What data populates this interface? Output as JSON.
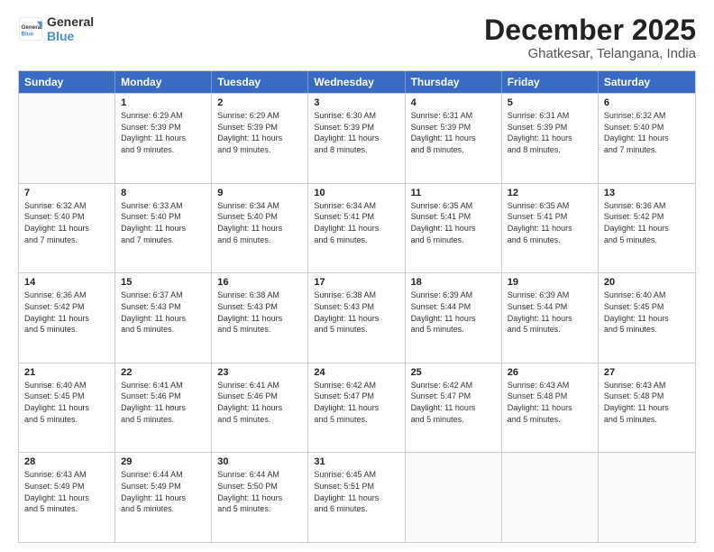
{
  "logo": {
    "line1": "General",
    "line2": "Blue"
  },
  "title": "December 2025",
  "subtitle": "Ghatkesar, Telangana, India",
  "headers": [
    "Sunday",
    "Monday",
    "Tuesday",
    "Wednesday",
    "Thursday",
    "Friday",
    "Saturday"
  ],
  "rows": [
    [
      {
        "day": "",
        "info": ""
      },
      {
        "day": "1",
        "info": "Sunrise: 6:29 AM\nSunset: 5:39 PM\nDaylight: 11 hours\nand 9 minutes."
      },
      {
        "day": "2",
        "info": "Sunrise: 6:29 AM\nSunset: 5:39 PM\nDaylight: 11 hours\nand 9 minutes."
      },
      {
        "day": "3",
        "info": "Sunrise: 6:30 AM\nSunset: 5:39 PM\nDaylight: 11 hours\nand 8 minutes."
      },
      {
        "day": "4",
        "info": "Sunrise: 6:31 AM\nSunset: 5:39 PM\nDaylight: 11 hours\nand 8 minutes."
      },
      {
        "day": "5",
        "info": "Sunrise: 6:31 AM\nSunset: 5:39 PM\nDaylight: 11 hours\nand 8 minutes."
      },
      {
        "day": "6",
        "info": "Sunrise: 6:32 AM\nSunset: 5:40 PM\nDaylight: 11 hours\nand 7 minutes."
      }
    ],
    [
      {
        "day": "7",
        "info": "Sunrise: 6:32 AM\nSunset: 5:40 PM\nDaylight: 11 hours\nand 7 minutes."
      },
      {
        "day": "8",
        "info": "Sunrise: 6:33 AM\nSunset: 5:40 PM\nDaylight: 11 hours\nand 7 minutes."
      },
      {
        "day": "9",
        "info": "Sunrise: 6:34 AM\nSunset: 5:40 PM\nDaylight: 11 hours\nand 6 minutes."
      },
      {
        "day": "10",
        "info": "Sunrise: 6:34 AM\nSunset: 5:41 PM\nDaylight: 11 hours\nand 6 minutes."
      },
      {
        "day": "11",
        "info": "Sunrise: 6:35 AM\nSunset: 5:41 PM\nDaylight: 11 hours\nand 6 minutes."
      },
      {
        "day": "12",
        "info": "Sunrise: 6:35 AM\nSunset: 5:41 PM\nDaylight: 11 hours\nand 6 minutes."
      },
      {
        "day": "13",
        "info": "Sunrise: 6:36 AM\nSunset: 5:42 PM\nDaylight: 11 hours\nand 5 minutes."
      }
    ],
    [
      {
        "day": "14",
        "info": "Sunrise: 6:36 AM\nSunset: 5:42 PM\nDaylight: 11 hours\nand 5 minutes."
      },
      {
        "day": "15",
        "info": "Sunrise: 6:37 AM\nSunset: 5:43 PM\nDaylight: 11 hours\nand 5 minutes."
      },
      {
        "day": "16",
        "info": "Sunrise: 6:38 AM\nSunset: 5:43 PM\nDaylight: 11 hours\nand 5 minutes."
      },
      {
        "day": "17",
        "info": "Sunrise: 6:38 AM\nSunset: 5:43 PM\nDaylight: 11 hours\nand 5 minutes."
      },
      {
        "day": "18",
        "info": "Sunrise: 6:39 AM\nSunset: 5:44 PM\nDaylight: 11 hours\nand 5 minutes."
      },
      {
        "day": "19",
        "info": "Sunrise: 6:39 AM\nSunset: 5:44 PM\nDaylight: 11 hours\nand 5 minutes."
      },
      {
        "day": "20",
        "info": "Sunrise: 6:40 AM\nSunset: 5:45 PM\nDaylight: 11 hours\nand 5 minutes."
      }
    ],
    [
      {
        "day": "21",
        "info": "Sunrise: 6:40 AM\nSunset: 5:45 PM\nDaylight: 11 hours\nand 5 minutes."
      },
      {
        "day": "22",
        "info": "Sunrise: 6:41 AM\nSunset: 5:46 PM\nDaylight: 11 hours\nand 5 minutes."
      },
      {
        "day": "23",
        "info": "Sunrise: 6:41 AM\nSunset: 5:46 PM\nDaylight: 11 hours\nand 5 minutes."
      },
      {
        "day": "24",
        "info": "Sunrise: 6:42 AM\nSunset: 5:47 PM\nDaylight: 11 hours\nand 5 minutes."
      },
      {
        "day": "25",
        "info": "Sunrise: 6:42 AM\nSunset: 5:47 PM\nDaylight: 11 hours\nand 5 minutes."
      },
      {
        "day": "26",
        "info": "Sunrise: 6:43 AM\nSunset: 5:48 PM\nDaylight: 11 hours\nand 5 minutes."
      },
      {
        "day": "27",
        "info": "Sunrise: 6:43 AM\nSunset: 5:48 PM\nDaylight: 11 hours\nand 5 minutes."
      }
    ],
    [
      {
        "day": "28",
        "info": "Sunrise: 6:43 AM\nSunset: 5:49 PM\nDaylight: 11 hours\nand 5 minutes."
      },
      {
        "day": "29",
        "info": "Sunrise: 6:44 AM\nSunset: 5:49 PM\nDaylight: 11 hours\nand 5 minutes."
      },
      {
        "day": "30",
        "info": "Sunrise: 6:44 AM\nSunset: 5:50 PM\nDaylight: 11 hours\nand 5 minutes."
      },
      {
        "day": "31",
        "info": "Sunrise: 6:45 AM\nSunset: 5:51 PM\nDaylight: 11 hours\nand 6 minutes."
      },
      {
        "day": "",
        "info": ""
      },
      {
        "day": "",
        "info": ""
      },
      {
        "day": "",
        "info": ""
      }
    ]
  ]
}
